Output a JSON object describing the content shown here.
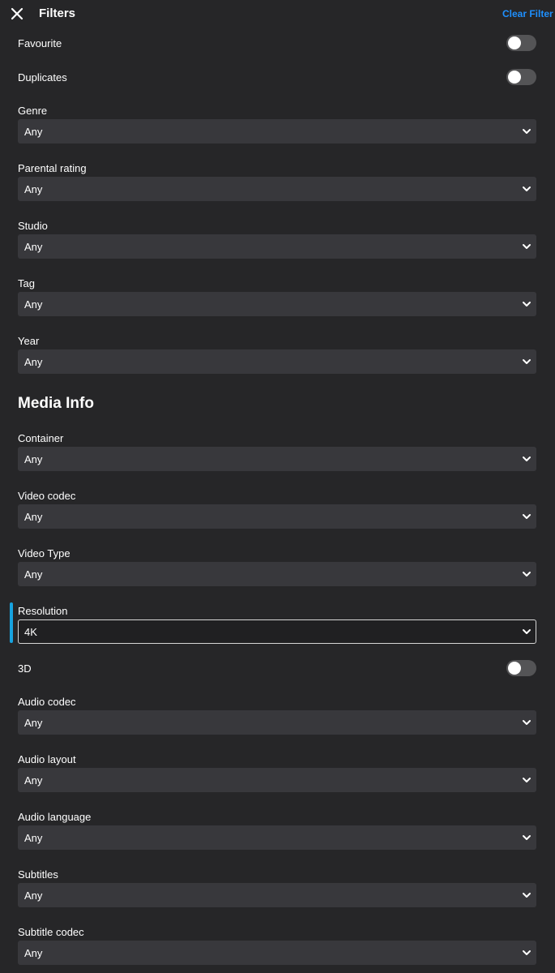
{
  "header": {
    "title": "Filters",
    "clear_label": "Clear Filter"
  },
  "toggles": {
    "favourite": {
      "label": "Favourite",
      "on": false
    },
    "duplicates": {
      "label": "Duplicates",
      "on": false
    },
    "three_d": {
      "label": "3D",
      "on": false
    }
  },
  "filters": {
    "genre": {
      "label": "Genre",
      "value": "Any"
    },
    "parental_rating": {
      "label": "Parental rating",
      "value": "Any"
    },
    "studio": {
      "label": "Studio",
      "value": "Any"
    },
    "tag": {
      "label": "Tag",
      "value": "Any"
    },
    "year": {
      "label": "Year",
      "value": "Any"
    }
  },
  "media_info": {
    "heading": "Media Info",
    "container": {
      "label": "Container",
      "value": "Any"
    },
    "video_codec": {
      "label": "Video codec",
      "value": "Any"
    },
    "video_type": {
      "label": "Video Type",
      "value": "Any"
    },
    "resolution": {
      "label": "Resolution",
      "value": "4K",
      "focused": true
    },
    "audio_codec": {
      "label": "Audio codec",
      "value": "Any"
    },
    "audio_layout": {
      "label": "Audio layout",
      "value": "Any"
    },
    "audio_language": {
      "label": "Audio language",
      "value": "Any"
    },
    "subtitles": {
      "label": "Subtitles",
      "value": "Any"
    },
    "subtitle_codec": {
      "label": "Subtitle codec",
      "value": "Any"
    }
  },
  "icons": {
    "close": "close-icon",
    "dropdown": "chevron-down-icon"
  },
  "colors": {
    "background": "#262628",
    "select_background": "#38383c",
    "accent_link": "#1e90ff",
    "focus_indicator": "#17a3e0"
  }
}
